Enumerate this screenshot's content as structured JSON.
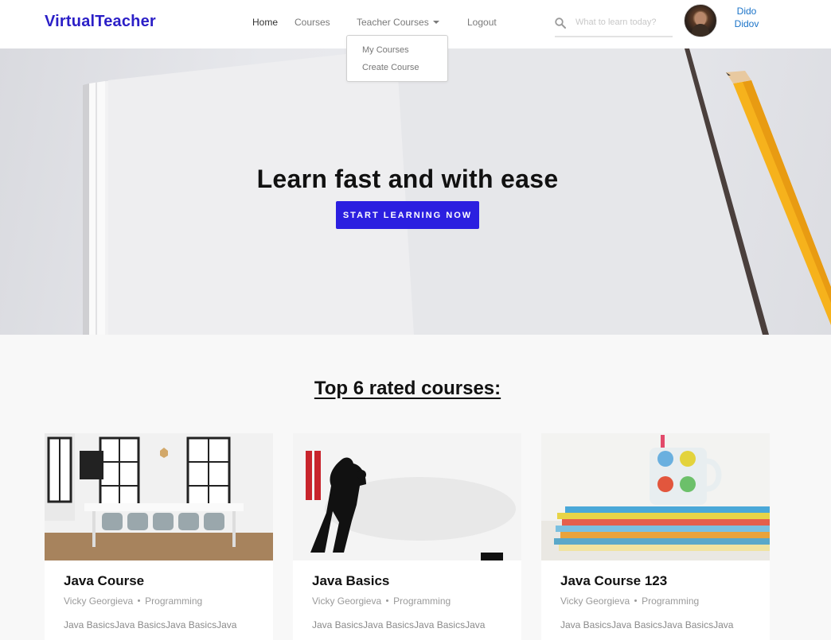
{
  "brand": "VirtualTeacher",
  "nav": {
    "home": "Home",
    "courses": "Courses",
    "teacher_courses": "Teacher Courses",
    "logout": "Logout"
  },
  "dropdown": {
    "items": [
      "My Courses",
      "Create Course"
    ]
  },
  "search": {
    "placeholder": "What to learn today?"
  },
  "user": {
    "first_name": "Dido",
    "last_name": "Didov"
  },
  "hero": {
    "title": "Learn fast and with ease",
    "button": "START LEARNING NOW"
  },
  "section": {
    "title": "Top 6 rated courses:"
  },
  "courses": [
    {
      "title": "Java Course",
      "teacher": "Vicky Georgieva",
      "category": "Programming",
      "description": "Java BasicsJava BasicsJava BasicsJava",
      "image": "meeting-room-photo"
    },
    {
      "title": "Java Basics",
      "teacher": "Vicky Georgieva",
      "category": "Programming",
      "description": "Java BasicsJava BasicsJava BasicsJava",
      "image": "boxing-poster"
    },
    {
      "title": "Java Course 123",
      "teacher": "Vicky Georgieva",
      "category": "Programming",
      "description": "Java BasicsJava BasicsJava BasicsJava",
      "image": "books-and-mug-photo"
    }
  ],
  "colors": {
    "brand": "#2b1fc7",
    "button": "#2b1fe0",
    "user_link": "#1a73c8"
  }
}
